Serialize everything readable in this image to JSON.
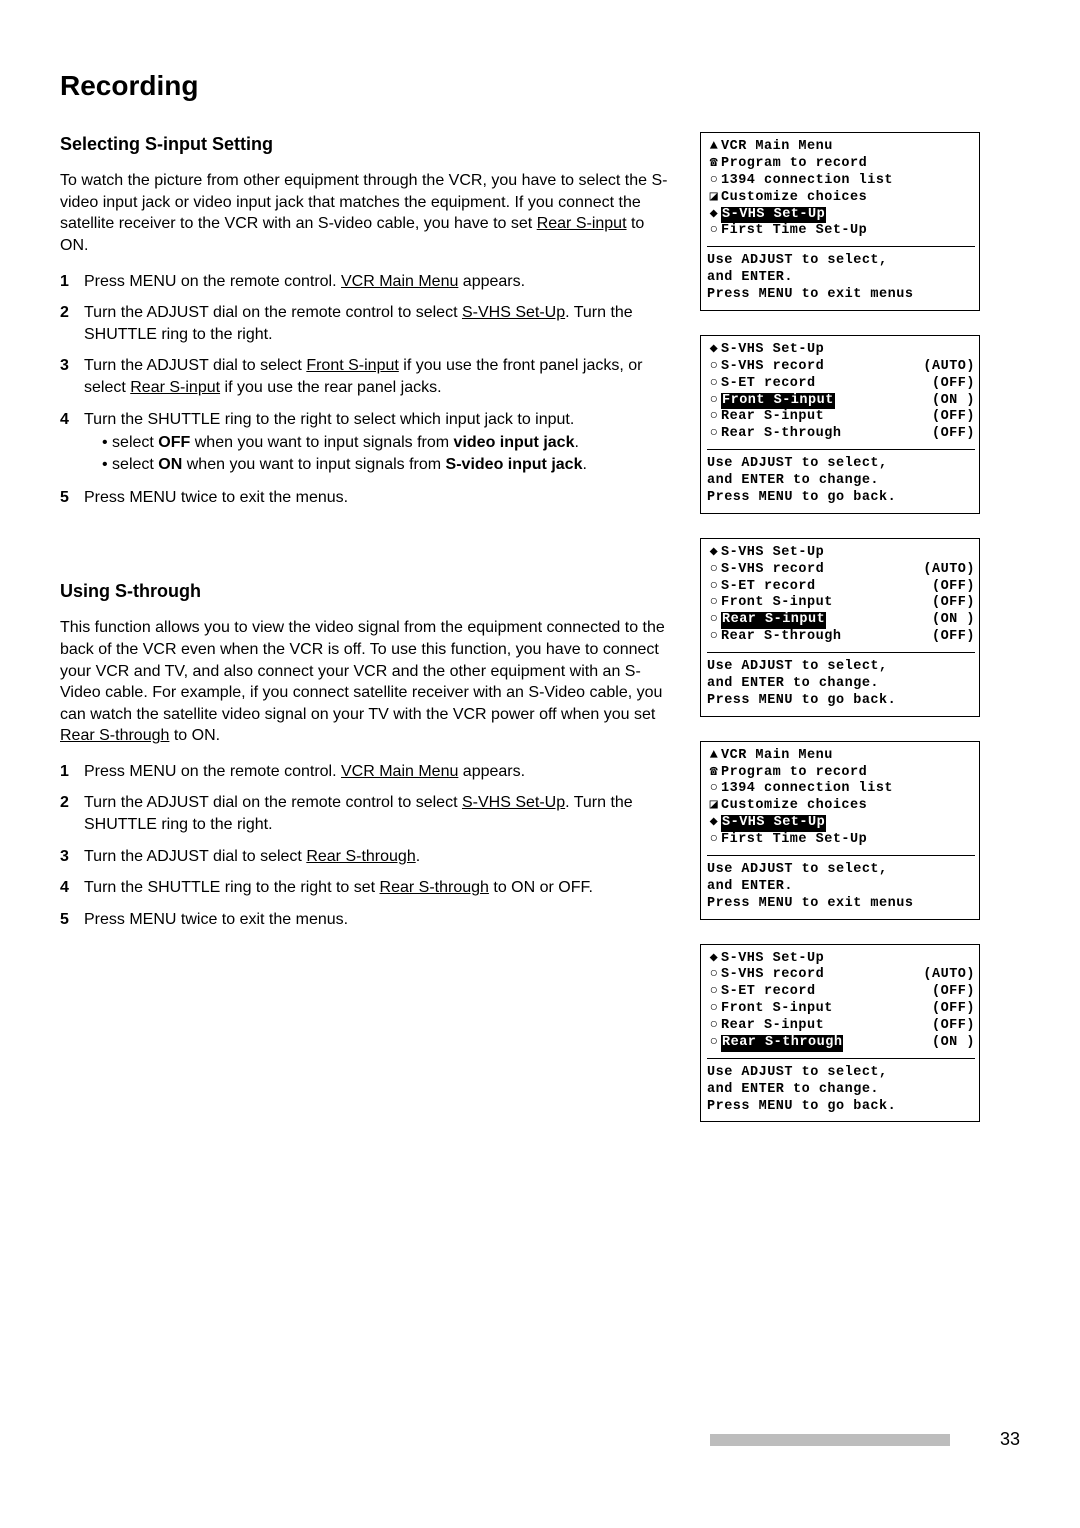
{
  "title": "Recording",
  "pageNumber": "33",
  "section1": {
    "heading": "Selecting S-input Setting",
    "intro": [
      "To watch the picture from other equipment through the VCR, you have to select the S-video input jack or video input jack that matches the equipment.  If you connect the satellite receiver to the VCR with an S-video cable, you have to set ",
      "Rear S-input",
      " to ON."
    ],
    "steps": [
      {
        "n": "1",
        "pre": "Press MENU on the remote control.  ",
        "u": "VCR Main Menu",
        "post": " appears."
      },
      {
        "n": "2",
        "pre": "Turn the ADJUST dial on the remote control to select ",
        "u": "S-VHS Set-Up",
        "post": ".  Turn the SHUTTLE ring to the right."
      },
      {
        "n": "3",
        "pre": "Turn the ADJUST dial to select ",
        "u": "Front S-input",
        "mid": " if you use the front panel jacks, or select ",
        "u2": "Rear S-input",
        "post": " if you use the rear panel jacks."
      },
      {
        "n": "4",
        "pre": "Turn the SHUTTLE ring to the right to select which input jack to input.",
        "bullets": [
          {
            "a": "select ",
            "b": "OFF",
            "c": " when you want to input signals from ",
            "d": "video input jack",
            "e": "."
          },
          {
            "a": "select ",
            "b": "ON",
            "c": " when you want to input signals from ",
            "d": "S-video input jack",
            "e": "."
          }
        ]
      },
      {
        "n": "5",
        "pre": "Press MENU twice to exit the menus."
      }
    ]
  },
  "section2": {
    "heading": "Using S-through",
    "intro": [
      "This function allows you to view the video signal from the equipment connected to the back of the VCR even when the VCR is off.  To use this function, you have to connect your VCR and TV, and also connect your VCR and the other equipment with an S-Video cable.  For example, if you connect satellite receiver with an S-Video cable, you can watch the satellite video signal on your TV with the VCR power off when you set ",
      "Rear S-through",
      " to ON."
    ],
    "steps": [
      {
        "n": "1",
        "pre": "Press MENU on the remote control.  ",
        "u": "VCR Main Menu",
        "post": " appears."
      },
      {
        "n": "2",
        "pre": "Turn the ADJUST dial on the remote control to select ",
        "u": "S-VHS Set-Up",
        "post": ".  Turn the SHUTTLE ring to the right."
      },
      {
        "n": "3",
        "pre": "Turn the ADJUST dial to select ",
        "u": "Rear S-through",
        "post": "."
      },
      {
        "n": "4",
        "pre": "Turn the SHUTTLE ring to the right to set ",
        "u": "Rear S-through",
        "post": " to ON or OFF."
      },
      {
        "n": "5",
        "pre": "Press MENU twice to exit the menus."
      }
    ]
  },
  "osd": [
    {
      "header": {
        "ico": "▲",
        "txt": "VCR Main Menu"
      },
      "rows": [
        {
          "ico": "☎",
          "txt": "Program to record"
        },
        {
          "ico": "○",
          "txt": "1394 connection list"
        },
        {
          "ico": "◪",
          "txt": "Customize choices"
        },
        {
          "ico": "◆",
          "txt": "S-VHS Set-Up",
          "hl": true
        },
        {
          "ico": "○",
          "txt": "First Time Set-Up"
        }
      ],
      "help": [
        "Use ADJUST to select,",
        "and ENTER.",
        "Press MENU to exit menus"
      ]
    },
    {
      "header": {
        "ico": "◆",
        "txt": "S-VHS Set-Up"
      },
      "rows": [
        {
          "ico": "○",
          "txt": "S-VHS record",
          "val": "(AUTO)"
        },
        {
          "ico": "○",
          "txt": "S-ET record",
          "val": "(OFF)"
        },
        {
          "ico": "○",
          "txt": "Front S-input",
          "val": "(ON )",
          "hl": true
        },
        {
          "ico": "○",
          "txt": "Rear S-input",
          "val": "(OFF)"
        },
        {
          "ico": "○",
          "txt": "Rear S-through",
          "val": "(OFF)"
        }
      ],
      "help": [
        "Use ADJUST to select,",
        "and ENTER to change.",
        "Press MENU to go back."
      ]
    },
    {
      "header": {
        "ico": "◆",
        "txt": "S-VHS Set-Up"
      },
      "rows": [
        {
          "ico": "○",
          "txt": "S-VHS record",
          "val": "(AUTO)"
        },
        {
          "ico": "○",
          "txt": "S-ET record",
          "val": "(OFF)"
        },
        {
          "ico": "○",
          "txt": "Front S-input",
          "val": "(OFF)"
        },
        {
          "ico": "○",
          "txt": "Rear S-input",
          "val": "(ON )",
          "hl": true
        },
        {
          "ico": "○",
          "txt": "Rear S-through",
          "val": "(OFF)"
        }
      ],
      "help": [
        "Use ADJUST to select,",
        "and ENTER to change.",
        "Press MENU to go back."
      ]
    },
    {
      "header": {
        "ico": "▲",
        "txt": "VCR Main Menu"
      },
      "rows": [
        {
          "ico": "☎",
          "txt": "Program to record"
        },
        {
          "ico": "○",
          "txt": "1394 connection list"
        },
        {
          "ico": "◪",
          "txt": "Customize choices"
        },
        {
          "ico": "◆",
          "txt": "S-VHS Set-Up",
          "hl": true
        },
        {
          "ico": "○",
          "txt": "First Time Set-Up"
        }
      ],
      "help": [
        "Use ADJUST to select,",
        "and ENTER.",
        "Press MENU to exit menus"
      ]
    },
    {
      "header": {
        "ico": "◆",
        "txt": "S-VHS Set-Up"
      },
      "rows": [
        {
          "ico": "○",
          "txt": "S-VHS record",
          "val": "(AUTO)"
        },
        {
          "ico": "○",
          "txt": "S-ET record",
          "val": "(OFF)"
        },
        {
          "ico": "○",
          "txt": "Front S-input",
          "val": "(OFF)"
        },
        {
          "ico": "○",
          "txt": "Rear S-input",
          "val": "(OFF)"
        },
        {
          "ico": "○",
          "txt": "Rear S-through",
          "val": "(ON )",
          "hl": true
        }
      ],
      "help": [
        "Use ADJUST to select,",
        "and ENTER to change.",
        "Press MENU to go back."
      ]
    }
  ]
}
